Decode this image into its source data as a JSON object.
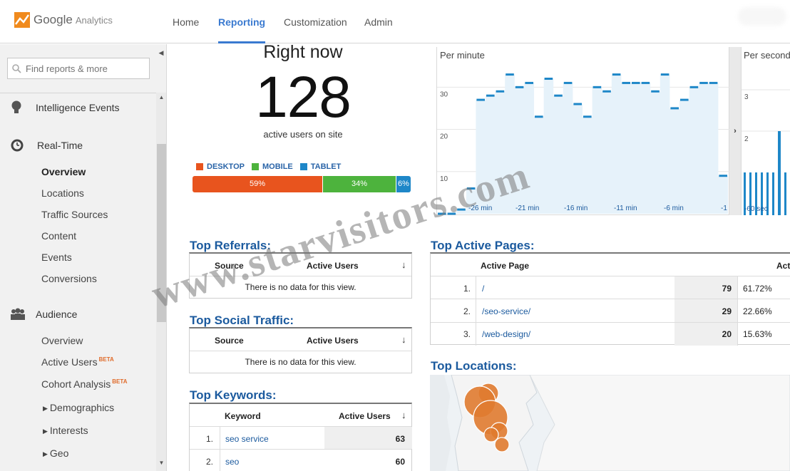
{
  "header": {
    "logo_google": "Google",
    "logo_analytics": "Analytics",
    "tabs": [
      {
        "label": "Home"
      },
      {
        "label": "Reporting"
      },
      {
        "label": "Customization"
      },
      {
        "label": "Admin"
      }
    ],
    "active_tab": "Reporting"
  },
  "sidebar": {
    "search_placeholder": "Find reports & more",
    "sections": {
      "intelligence": "Intelligence Events",
      "realtime": "Real-Time",
      "audience": "Audience"
    },
    "realtime_items": [
      "Overview",
      "Locations",
      "Traffic Sources",
      "Content",
      "Events",
      "Conversions"
    ],
    "audience_items": {
      "overview": "Overview",
      "active_users": "Active Users",
      "cohort": "Cohort Analysis",
      "beta": "BETA",
      "demographics": "Demographics",
      "interests": "Interests",
      "geo": "Geo"
    }
  },
  "right_now": {
    "title": "Right now",
    "count": "128",
    "label": "active users on site",
    "legend": [
      {
        "label": "DESKTOP",
        "color": "#e8541e"
      },
      {
        "label": "MOBILE",
        "color": "#4db33d"
      },
      {
        "label": "TABLET",
        "color": "#1e87c8"
      }
    ],
    "segments": [
      {
        "label": "59%",
        "value": 59,
        "color": "#e8541e"
      },
      {
        "label": "34%",
        "value": 34,
        "color": "#4db33d"
      },
      {
        "label": "6%",
        "value": 6,
        "color": "#1e87c8"
      }
    ]
  },
  "per_minute": {
    "title": "Per minute",
    "y_ticks": [
      "30",
      "20",
      "10"
    ],
    "x_ticks": [
      "-26 min",
      "-21 min",
      "-16 min",
      "-11 min",
      "-6 min",
      "-1"
    ],
    "values": [
      0,
      0,
      1,
      6,
      27,
      28,
      29,
      33,
      30,
      31,
      23,
      32,
      28,
      31,
      26,
      23,
      30,
      29,
      33,
      31,
      31,
      31,
      29,
      33,
      25,
      27,
      30,
      31,
      31,
      9
    ]
  },
  "per_second": {
    "title": "Per second",
    "y_ticks": [
      "3",
      "2"
    ],
    "x_tick": "-60 sec"
  },
  "top_referrals": {
    "title": "Top Referrals:",
    "col_source": "Source",
    "col_users": "Active Users",
    "sort_icon": "arrow-down",
    "nodata": "There is no data for this view."
  },
  "top_social": {
    "title": "Top Social Traffic:",
    "col_source": "Source",
    "col_users": "Active Users",
    "nodata": "There is no data for this view."
  },
  "top_keywords": {
    "title": "Top Keywords:",
    "col_keyword": "Keyword",
    "col_users": "Active Users",
    "rows": [
      {
        "idx": "1.",
        "keyword": "seo service",
        "value": "63"
      },
      {
        "idx": "2.",
        "keyword": "seo",
        "value": "60"
      }
    ]
  },
  "top_pages": {
    "title": "Top Active Pages:",
    "col_page": "Active Page",
    "col_users": "Act",
    "rows": [
      {
        "idx": "1.",
        "page": "/",
        "value": "79",
        "pct": "61.72%"
      },
      {
        "idx": "2.",
        "page": "/seo-service/",
        "value": "29",
        "pct": "22.66%"
      },
      {
        "idx": "3.",
        "page": "/web-design/",
        "value": "20",
        "pct": "15.63%"
      }
    ]
  },
  "top_locations": {
    "title": "Top Locations:"
  },
  "watermark": "www.starvisitors.com",
  "colors": {
    "accent": "#3a7ad0",
    "title_blue": "#1b5a9e",
    "chart_line": "#1e87c8",
    "chart_fill": "#e6f2fa",
    "map_dot": "#e07b30"
  }
}
